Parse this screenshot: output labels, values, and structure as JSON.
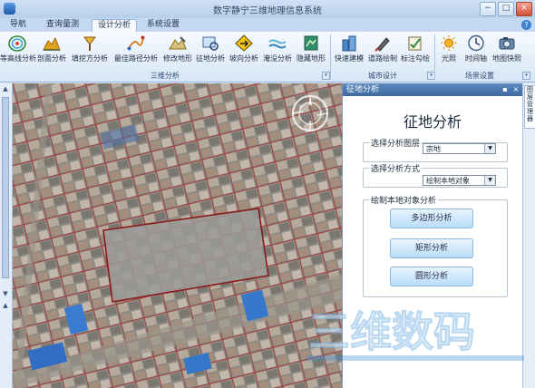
{
  "app": {
    "title": "数字静宁三维地理信息系统"
  },
  "window_controls": {
    "minimize": "−",
    "maximize": "□",
    "close": "×"
  },
  "tabs": [
    {
      "label": "导航"
    },
    {
      "label": "查询量测"
    },
    {
      "label": "设计分析"
    },
    {
      "label": "系统设置"
    }
  ],
  "active_tab": "设计分析",
  "help": "?",
  "ribbon": {
    "groups": [
      {
        "label": "三维分析",
        "items": [
          "等高线分析",
          "剖面分析",
          "填挖方分析",
          "最佳路径分析",
          "修改地形",
          "征地分析",
          "坡向分析",
          "淹没分析",
          "隐藏地形"
        ]
      },
      {
        "label": "城市设计",
        "items": [
          "快速建模",
          "道路绘制",
          "标注勾绘"
        ]
      },
      {
        "label": "场景设置",
        "items": [
          "光照",
          "时间轴",
          "地图快照"
        ]
      }
    ]
  },
  "panel": {
    "header": "征地分析",
    "pin": "📌",
    "close": "×",
    "title": "征地分析",
    "layer_section": {
      "legend": "选择分析图层",
      "value": "宗地"
    },
    "method_section": {
      "legend": "选择分析方式",
      "value": "绘制本地对象"
    },
    "draw_section": {
      "legend": "绘制本地对象分析",
      "buttons": [
        "多边形分析",
        "矩形分析",
        "圆形分析"
      ]
    }
  },
  "side_tab": "图层管理器",
  "watermark": "三维数码",
  "colors": {
    "accent": "#3f6aa0",
    "selection": "#8b1a1a",
    "button": "#b9dcf6"
  }
}
